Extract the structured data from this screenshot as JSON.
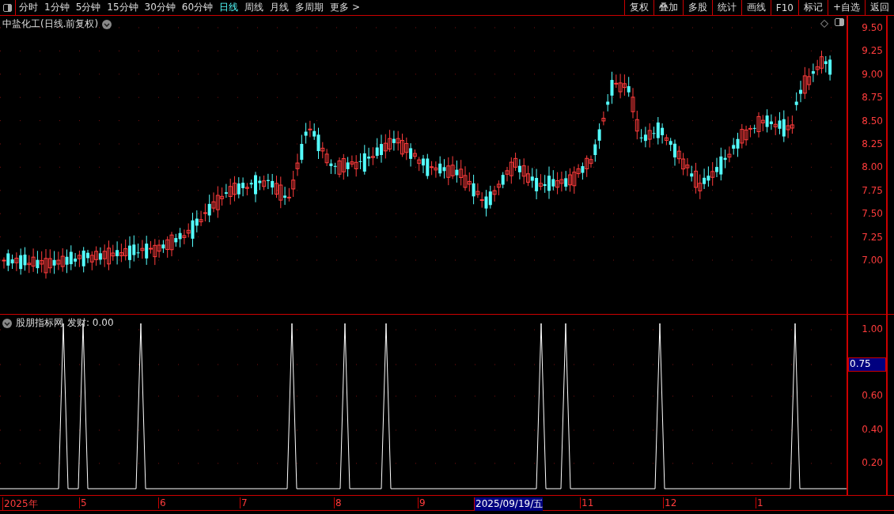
{
  "toolbar": {
    "periods": [
      {
        "label": "分时",
        "selected": false
      },
      {
        "label": "1分钟",
        "selected": false
      },
      {
        "label": "5分钟",
        "selected": false
      },
      {
        "label": "15分钟",
        "selected": false
      },
      {
        "label": "30分钟",
        "selected": false
      },
      {
        "label": "60分钟",
        "selected": false
      },
      {
        "label": "日线",
        "selected": true
      },
      {
        "label": "周线",
        "selected": false
      },
      {
        "label": "月线",
        "selected": false
      },
      {
        "label": "多周期",
        "selected": false
      },
      {
        "label": "更多 >",
        "selected": false
      }
    ],
    "actions": [
      "复权",
      "叠加",
      "多股",
      "统计",
      "画线",
      "F10",
      "标记",
      "+自选",
      "返回"
    ]
  },
  "main_chart": {
    "title": "中盐化工(日线.前复权)",
    "price_ticks": [
      "9.50",
      "9.25",
      "9.00",
      "8.75",
      "8.50",
      "8.25",
      "8.00",
      "7.75",
      "7.50",
      "7.25",
      "7.00"
    ]
  },
  "indicator": {
    "name": "股朋指标网",
    "reading": "发财: 0.00",
    "ticks": [
      "1.00",
      "0.60",
      "0.40",
      "0.20"
    ],
    "cursor_value": "0.75"
  },
  "date_axis": {
    "labels": [
      {
        "text": "2025年",
        "selected": false
      },
      {
        "text": "5",
        "selected": false
      },
      {
        "text": "6",
        "selected": false
      },
      {
        "text": "7",
        "selected": false
      },
      {
        "text": "8",
        "selected": false
      },
      {
        "text": "9",
        "selected": false
      },
      {
        "text": "2025/09/19/五",
        "selected": true
      },
      {
        "text": "11",
        "selected": false
      },
      {
        "text": "12",
        "selected": false
      },
      {
        "text": "1",
        "selected": false
      }
    ]
  }
}
